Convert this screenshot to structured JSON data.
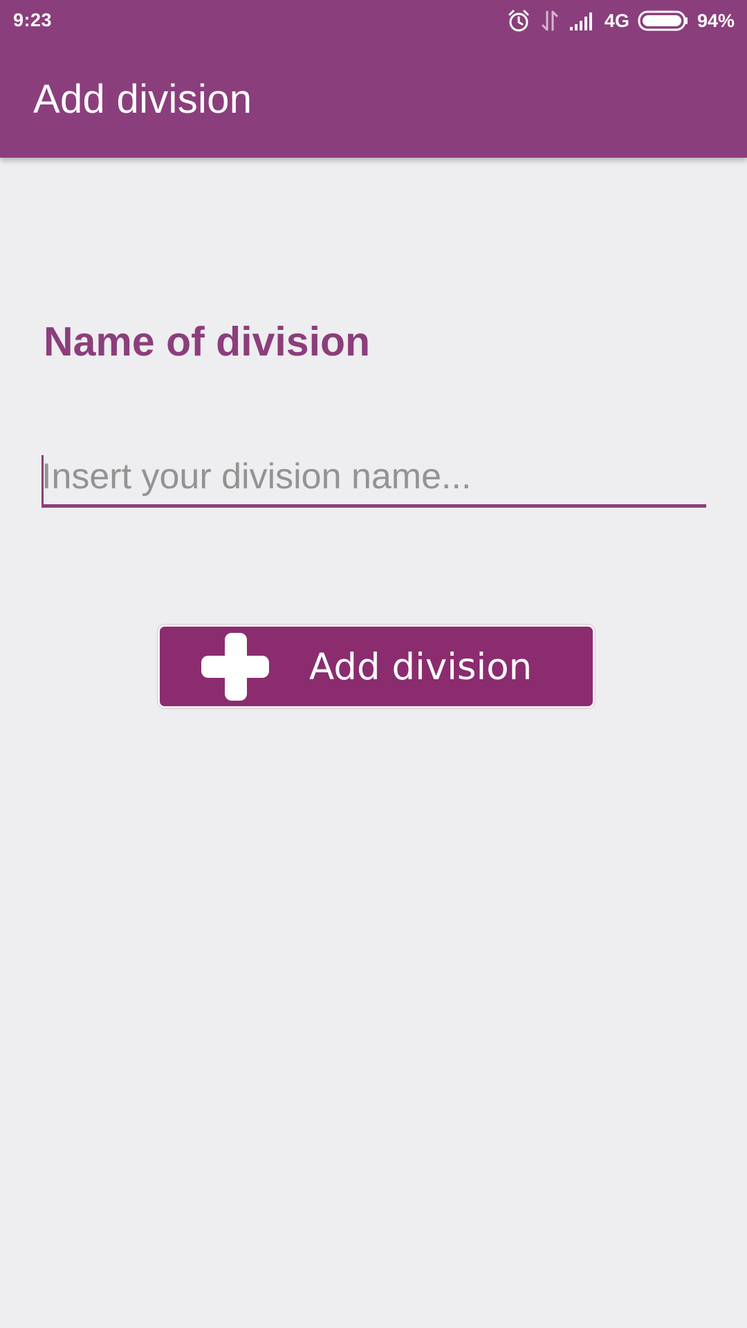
{
  "status_bar": {
    "time": "9:23",
    "network": "4G",
    "battery_percent": "94%",
    "icons": [
      "alarm-icon",
      "data-transfer-icon",
      "signal-icon",
      "battery-icon"
    ]
  },
  "app_bar": {
    "title": "Add division"
  },
  "form": {
    "label": "Name of division",
    "input_value": "",
    "input_placeholder": "Insert your division name...",
    "submit_label": "Add division",
    "submit_icon": "plus-icon"
  },
  "colors": {
    "primary": "#8b3e7c",
    "button": "#8b2c6f",
    "background": "#eeedef",
    "placeholder": "#939393"
  }
}
